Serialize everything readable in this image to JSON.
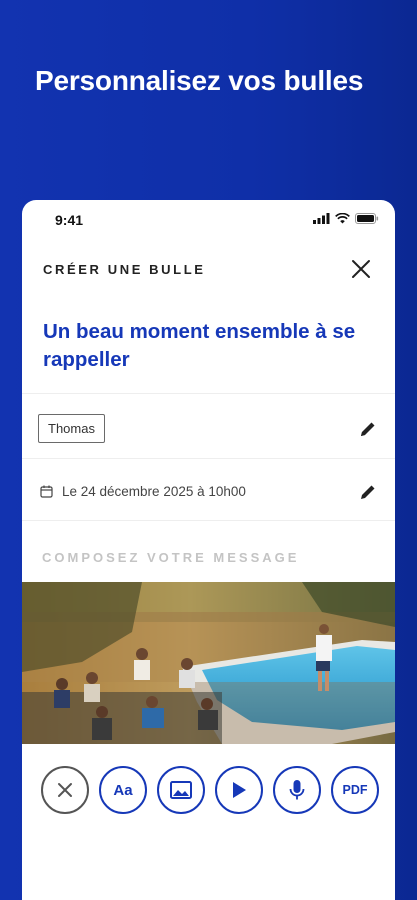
{
  "promo": {
    "headline": "Personnalisez vos bulles"
  },
  "status_bar": {
    "time": "9:41"
  },
  "header": {
    "title": "CRÉER UNE BULLE"
  },
  "bubble": {
    "title": "Un beau moment ensemble à se rappeller"
  },
  "recipient": {
    "name": "Thomas"
  },
  "schedule": {
    "date_text": "Le 24 décembre 2025 à 10h00"
  },
  "compose": {
    "label": "COMPOSEZ VOTRE MESSAGE"
  },
  "toolbar": {
    "text_label": "Aa",
    "pdf_label": "PDF",
    "icons": [
      "close-icon",
      "text-icon",
      "image-icon",
      "play-icon",
      "microphone-icon",
      "pdf-icon"
    ]
  },
  "colors": {
    "brand_blue": "#1638b8",
    "background_blue": "#1233b0"
  }
}
